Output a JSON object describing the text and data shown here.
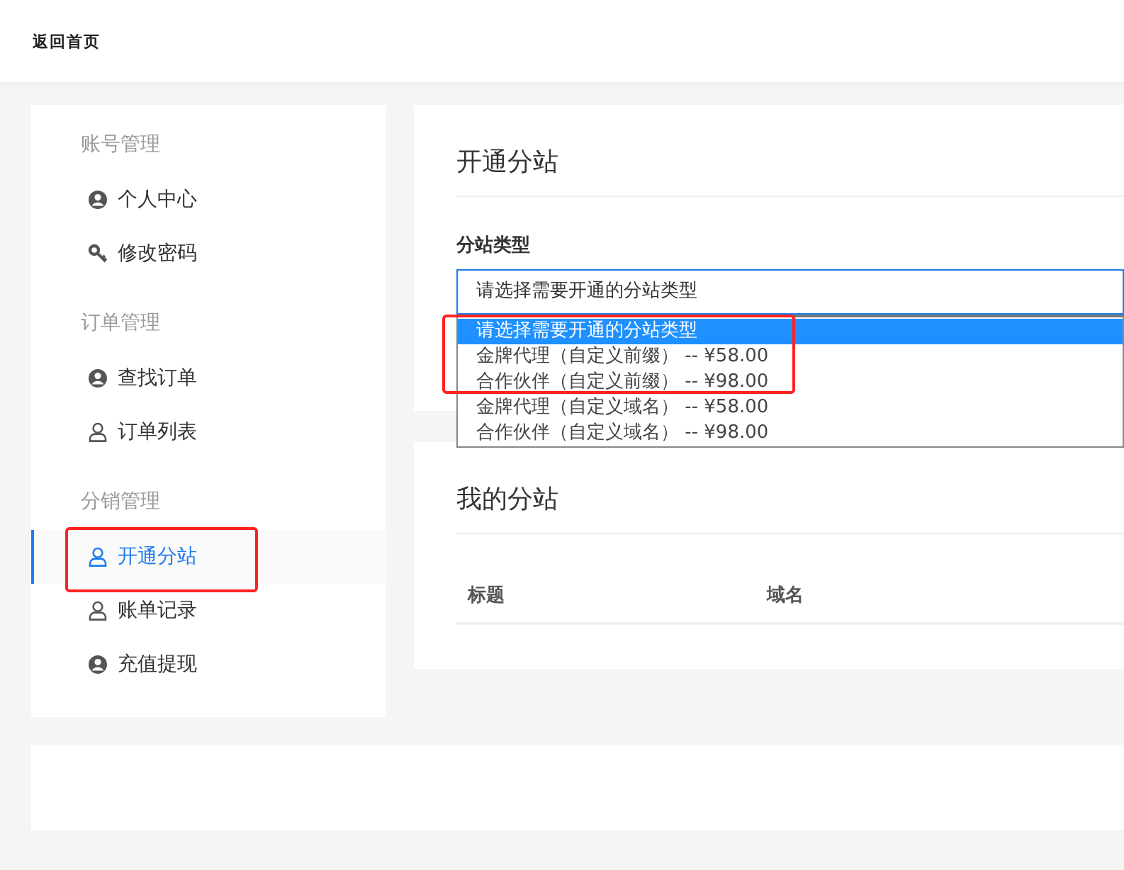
{
  "header": {
    "back_link": "返回首页"
  },
  "sidebar": {
    "groups": [
      {
        "title": "账号管理",
        "items": [
          {
            "label": "个人中心",
            "kind": "account",
            "selected": false
          },
          {
            "label": "修改密码",
            "kind": "key",
            "selected": false
          }
        ]
      },
      {
        "title": "订单管理",
        "items": [
          {
            "label": "查找订单",
            "kind": "account",
            "selected": false
          },
          {
            "label": "订单列表",
            "kind": "person",
            "selected": false
          }
        ]
      },
      {
        "title": "分销管理",
        "items": [
          {
            "label": "开通分站",
            "kind": "person",
            "selected": true
          },
          {
            "label": "账单记录",
            "kind": "person",
            "selected": false
          },
          {
            "label": "充值提现",
            "kind": "account",
            "selected": false
          }
        ]
      }
    ]
  },
  "open_station": {
    "title": "开通分站",
    "field_label": "分站类型",
    "select": {
      "value": "请选择需要开通的分站类型",
      "options": [
        {
          "label": "请选择需要开通的分站类型",
          "selected": true
        },
        {
          "label": "金牌代理（自定义前缀） -- ¥58.00",
          "selected": false
        },
        {
          "label": "合作伙伴（自定义前缀） -- ¥98.00",
          "selected": false
        },
        {
          "label": "金牌代理（自定义域名） -- ¥58.00",
          "selected": false
        },
        {
          "label": "合作伙伴（自定义域名） -- ¥98.00",
          "selected": false
        }
      ]
    }
  },
  "my_stations": {
    "title": "我的分站",
    "table": {
      "columns": [
        "标题",
        "域名"
      ]
    }
  }
}
